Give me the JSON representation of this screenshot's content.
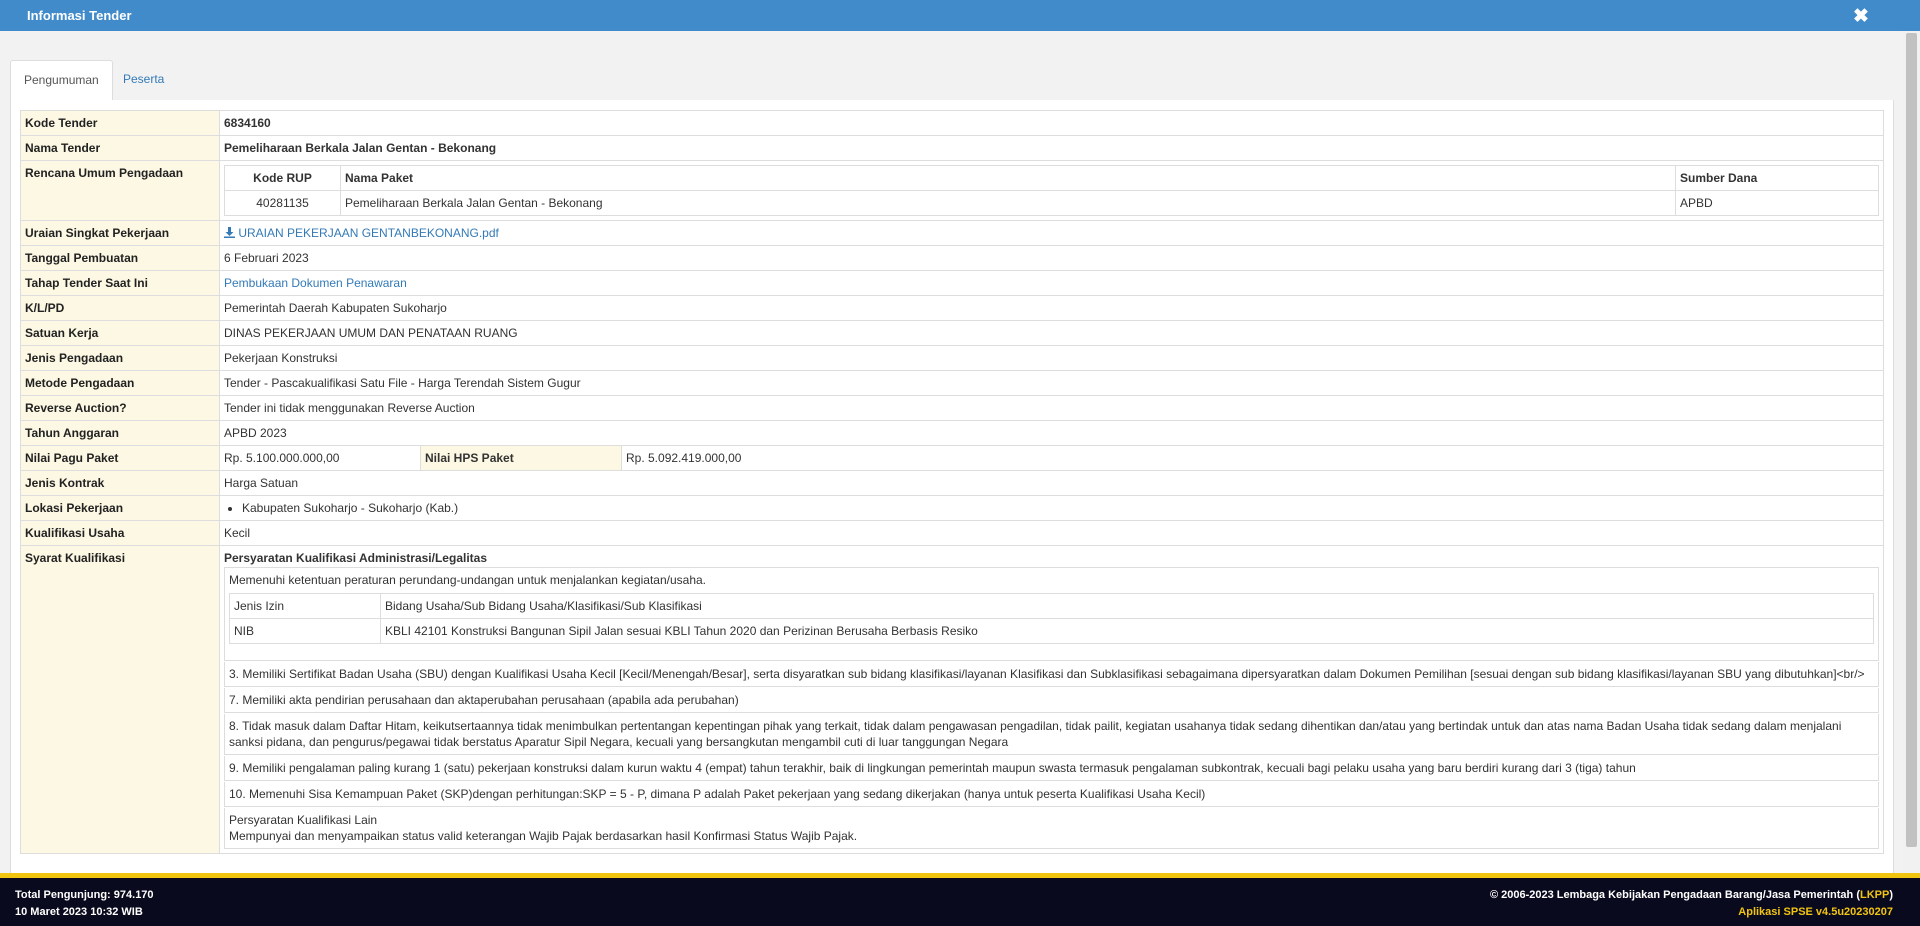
{
  "modal": {
    "title": "Informasi Tender",
    "close_symbol": "✖"
  },
  "tabs": [
    {
      "label": "Pengumuman",
      "active": true
    },
    {
      "label": "Peserta",
      "active": false
    }
  ],
  "tender": {
    "kode_tender": {
      "label": "Kode Tender",
      "value": "6834160"
    },
    "nama_tender": {
      "label": "Nama Tender",
      "value": "Pemeliharaan Berkala Jalan Gentan - Bekonang"
    },
    "rup": {
      "label": "Rencana Umum Pengadaan",
      "headers": [
        "Kode RUP",
        "Nama Paket",
        "Sumber Dana"
      ],
      "rows": [
        [
          "40281135",
          "Pemeliharaan Berkala Jalan Gentan - Bekonang",
          "APBD"
        ]
      ]
    },
    "uraian": {
      "label": "Uraian Singkat Pekerjaan",
      "file": "URAIAN PEKERJAAN GENTANBEKONANG.pdf",
      "icon": "download-icon"
    },
    "tanggal": {
      "label": "Tanggal Pembuatan",
      "value": "6 Februari 2023"
    },
    "tahap": {
      "label": "Tahap Tender Saat Ini",
      "value": "Pembukaan Dokumen Penawaran"
    },
    "klpd": {
      "label": "K/L/PD",
      "value": "Pemerintah Daerah Kabupaten Sukoharjo"
    },
    "satuan_kerja": {
      "label": "Satuan Kerja",
      "value": "DINAS PEKERJAAN UMUM DAN PENATAAN RUANG"
    },
    "jenis_pengadaan": {
      "label": "Jenis Pengadaan",
      "value": "Pekerjaan Konstruksi"
    },
    "metode": {
      "label": "Metode Pengadaan",
      "value": "Tender - Pascakualifikasi Satu File - Harga Terendah Sistem Gugur"
    },
    "reverse": {
      "label": "Reverse Auction?",
      "value": "Tender ini tidak menggunakan Reverse Auction"
    },
    "tahun": {
      "label": "Tahun Anggaran",
      "value": "APBD 2023"
    },
    "pagu": {
      "label": "Nilai Pagu Paket",
      "value": "Rp. 5.100.000.000,00",
      "hps_label": "Nilai HPS Paket",
      "hps_value": "Rp. 5.092.419.000,00"
    },
    "jenis_kontrak": {
      "label": "Jenis Kontrak",
      "value": "Harga Satuan"
    },
    "lokasi": {
      "label": "Lokasi Pekerjaan",
      "items": [
        "Kabupaten Sukoharjo - Sukoharjo (Kab.)"
      ]
    },
    "kualifikasi_usaha": {
      "label": "Kualifikasi Usaha",
      "value": "Kecil"
    },
    "syarat": {
      "label": "Syarat Kualifikasi",
      "heading": "Persyaratan Kualifikasi Administrasi/Legalitas",
      "intro": "Memenuhi ketentuan peraturan perundang-undangan untuk menjalankan kegiatan/usaha.",
      "izin_headers": [
        "Jenis Izin",
        "Bidang Usaha/Sub Bidang Usaha/Klasifikasi/Sub Klasifikasi"
      ],
      "izin_rows": [
        [
          "NIB",
          "KBLI 42101 Konstruksi Bangunan Sipil Jalan sesuai KBLI Tahun 2020 dan Perizinan Berusaha Berbasis Resiko"
        ]
      ],
      "items": [
        "3. Memiliki Sertifikat Badan Usaha (SBU) dengan Kualifikasi Usaha Kecil [Kecil/Menengah/Besar], serta disyaratkan sub bidang klasifikasi/layanan Klasifikasi dan Subklasifikasi sebagaimana dipersyaratkan dalam Dokumen Pemilihan [sesuai dengan sub bidang klasifikasi/layanan SBU yang dibutuhkan]<br/>",
        "7. Memiliki akta pendirian perusahaan dan aktaperubahan perusahaan (apabila ada perubahan)",
        "8. Tidak masuk dalam Daftar Hitam, keikutsertaannya tidak menimbulkan pertentangan kepentingan pihak yang terkait, tidak dalam pengawasan pengadilan, tidak pailit, kegiatan usahanya tidak sedang dihentikan dan/atau yang bertindak untuk dan atas nama Badan Usaha tidak sedang dalam menjalani sanksi pidana, dan pengurus/pegawai tidak berstatus Aparatur Sipil Negara, kecuali yang bersangkutan mengambil cuti di luar tanggungan Negara",
        "9. Memiliki pengalaman paling kurang 1 (satu) pekerjaan konstruksi dalam kurun waktu 4 (empat) tahun terakhir, baik di lingkungan pemerintah maupun swasta termasuk pengalaman subkontrak, kecuali bagi pelaku usaha yang baru berdiri kurang dari 3 (tiga) tahun",
        "10. Memenuhi Sisa Kemampuan Paket (SKP)dengan perhitungan:SKP = 5 - P, dimana P adalah Paket pekerjaan yang sedang dikerjakan (hanya untuk peserta Kualifikasi Usaha Kecil)"
      ],
      "lain_heading": "Persyaratan Kualifikasi Lain",
      "lain_text": "Mempunyai dan menyampaikan status valid keterangan Wajib Pajak berdasarkan hasil Konfirmasi Status Wajib Pajak."
    }
  },
  "footer": {
    "visitors": "Total Pengunjung: 974.170",
    "datetime": "10 Maret 2023 10:32 WIB",
    "copyright_prefix": "© 2006-2023 Lembaga Kebijakan Pengadaan Barang/Jasa Pemerintah (",
    "copyright_abbr": "LKPP",
    "copyright_suffix": ")",
    "version": "Aplikasi SPSE v4.5u20230207"
  },
  "colors": {
    "header": "#428bca",
    "label_bg": "#fcf8e3",
    "link": "#337ab7",
    "footer_bg": "#0a0a1e",
    "footer_accent": "#f1c40f"
  }
}
